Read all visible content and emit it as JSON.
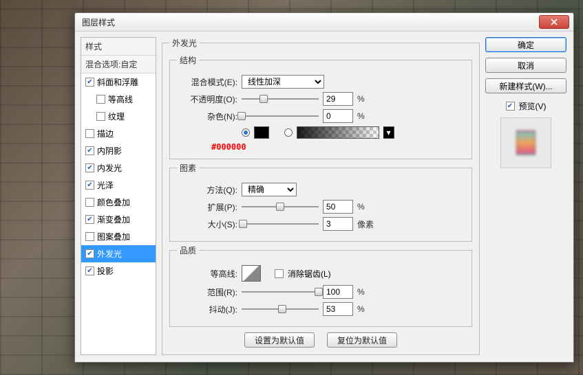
{
  "dialog": {
    "title": "图层样式"
  },
  "styles": {
    "header": "样式",
    "blending": "混合选项:自定",
    "items": [
      {
        "label": "斜面和浮雕",
        "checked": true,
        "indent": false
      },
      {
        "label": "等高线",
        "checked": false,
        "indent": true
      },
      {
        "label": "纹理",
        "checked": false,
        "indent": true
      },
      {
        "label": "描边",
        "checked": false,
        "indent": false
      },
      {
        "label": "内阴影",
        "checked": true,
        "indent": false
      },
      {
        "label": "内发光",
        "checked": true,
        "indent": false
      },
      {
        "label": "光泽",
        "checked": true,
        "indent": false
      },
      {
        "label": "颜色叠加",
        "checked": false,
        "indent": false
      },
      {
        "label": "渐变叠加",
        "checked": true,
        "indent": false
      },
      {
        "label": "图案叠加",
        "checked": false,
        "indent": false
      },
      {
        "label": "外发光",
        "checked": true,
        "indent": false,
        "selected": true
      },
      {
        "label": "投影",
        "checked": true,
        "indent": false
      }
    ]
  },
  "panel": {
    "title": "外发光",
    "structure": {
      "group": "结构",
      "blend_label": "混合模式(E):",
      "blend_value": "线性加深",
      "opacity_label": "不透明度(O):",
      "opacity_value": "29",
      "opacity_unit": "%",
      "opacity_pct": 29,
      "noise_label": "杂色(N):",
      "noise_value": "0",
      "noise_unit": "%",
      "noise_pct": 0,
      "color_hex_annotation": "#000000"
    },
    "elements": {
      "group": "图素",
      "technique_label": "方法(Q):",
      "technique_value": "精确",
      "spread_label": "扩展(P):",
      "spread_value": "50",
      "spread_unit": "%",
      "spread_pct": 50,
      "size_label": "大小(S):",
      "size_value": "3",
      "size_unit": "像素",
      "size_pct": 2
    },
    "quality": {
      "group": "品质",
      "contour_label": "等高线:",
      "antialias_label": "消除锯齿(L)",
      "antialias_checked": false,
      "range_label": "范围(R):",
      "range_value": "100",
      "range_unit": "%",
      "range_pct": 100,
      "jitter_label": "抖动(J):",
      "jitter_value": "53",
      "jitter_unit": "%",
      "jitter_pct": 53
    },
    "buttons": {
      "set_default": "设置为默认值",
      "reset_default": "复位为默认值"
    }
  },
  "right": {
    "ok": "确定",
    "cancel": "取消",
    "new_style": "新建样式(W)...",
    "preview_label": "预览(V)",
    "preview_checked": true
  }
}
